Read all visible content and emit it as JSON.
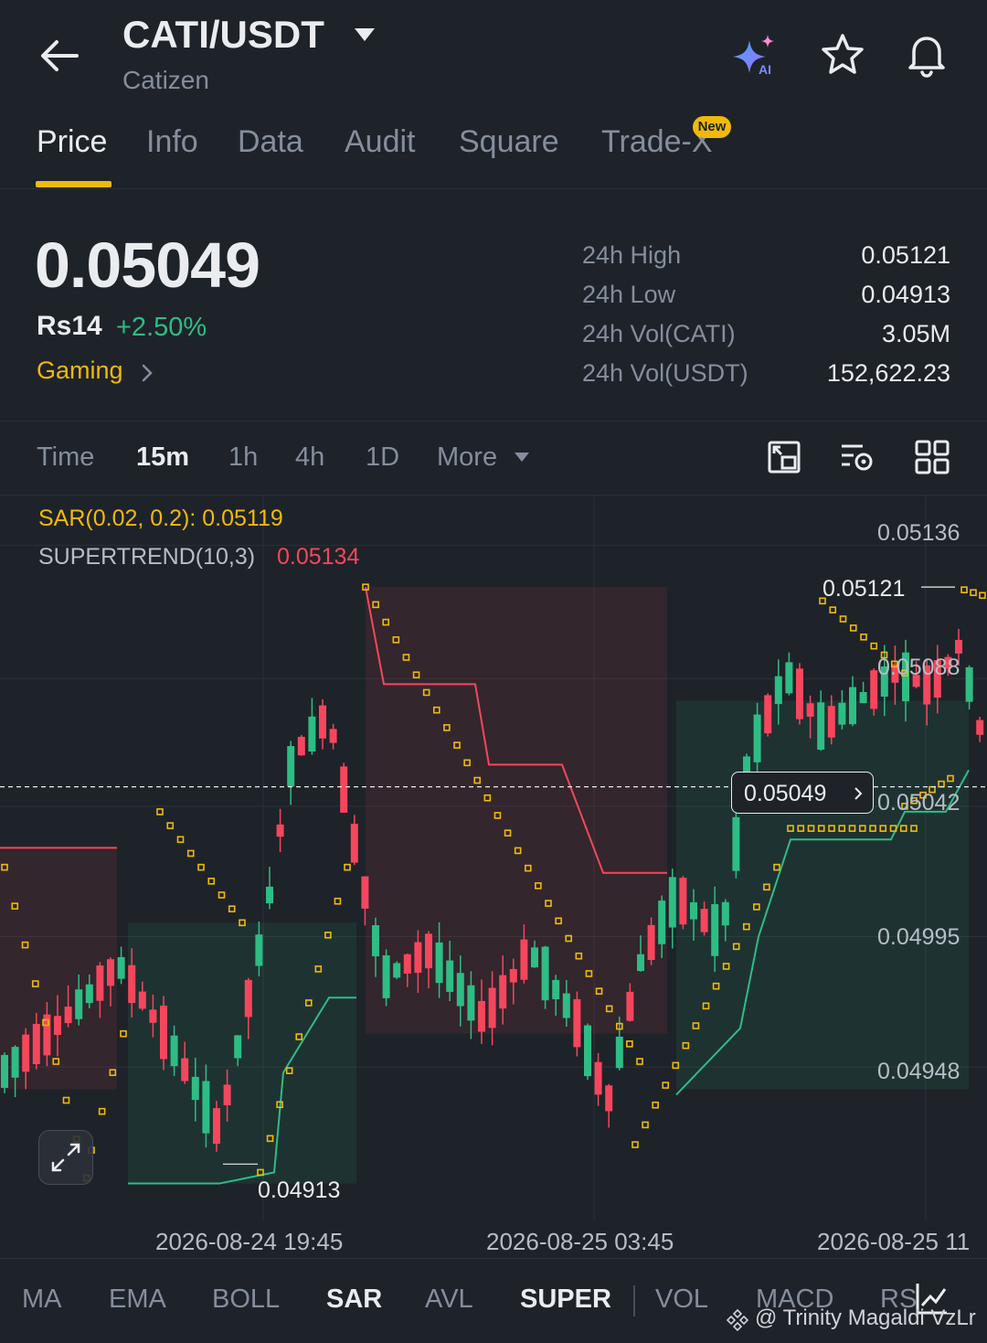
{
  "header": {
    "pair": "CATI/USDT",
    "subtitle": "Catizen",
    "icons": [
      "arrow-left-icon",
      "ai-sparkle-icon",
      "star-icon",
      "bell-icon"
    ]
  },
  "tabs": [
    {
      "label": "Price",
      "active": true
    },
    {
      "label": "Info"
    },
    {
      "label": "Data"
    },
    {
      "label": "Audit"
    },
    {
      "label": "Square"
    },
    {
      "label": "Trade-X",
      "badge": "New"
    }
  ],
  "price": {
    "last": "0.05049",
    "fiat": "Rs14",
    "change": "+2.50%",
    "sector": "Gaming"
  },
  "stats": [
    {
      "label": "24h High",
      "value": "0.05121"
    },
    {
      "label": "24h Low",
      "value": "0.04913"
    },
    {
      "label": "24h Vol(CATI)",
      "value": "3.05M"
    },
    {
      "label": "24h Vol(USDT)",
      "value": "152,622.23"
    }
  ],
  "intervals": {
    "items": [
      "Time",
      "15m",
      "1h",
      "4h",
      "1D"
    ],
    "selected": "15m",
    "more_label": "More"
  },
  "indicators": {
    "sar_label": "SAR(0.02, 0.2): 0.05119",
    "supertrend_label": "SUPERTREND(10,3)",
    "supertrend_value": "0.05134"
  },
  "chart_data": {
    "type": "candlestick",
    "y_axis_labels": [
      "0.05136",
      "0.05088",
      "0.05042",
      "0.04995",
      "0.04948"
    ],
    "y_axis_values": [
      0.05136,
      0.05088,
      0.05042,
      0.04995,
      0.04948
    ],
    "x_axis_labels": [
      "2026-08-24 19:45",
      "2026-08-25 03:45",
      "2026-08-25 11"
    ],
    "ylim": [
      0.04893,
      0.05154
    ],
    "high_marker": "0.05121",
    "low_marker": "0.04913",
    "last_price": "0.05049",
    "grid": true,
    "colors": {
      "up": "#2ebd85",
      "down": "#f6465d",
      "sar": "#f0b90b",
      "background": "#1e2329"
    }
  },
  "bottom_bar": {
    "items": [
      "MA",
      "EMA",
      "BOLL",
      "SAR",
      "AVL",
      "SUPER",
      "VOL",
      "MACD",
      "RS"
    ],
    "active": [
      "SAR",
      "SUPER"
    ],
    "watermark": "@ Trinity Magaldi VzLr"
  }
}
